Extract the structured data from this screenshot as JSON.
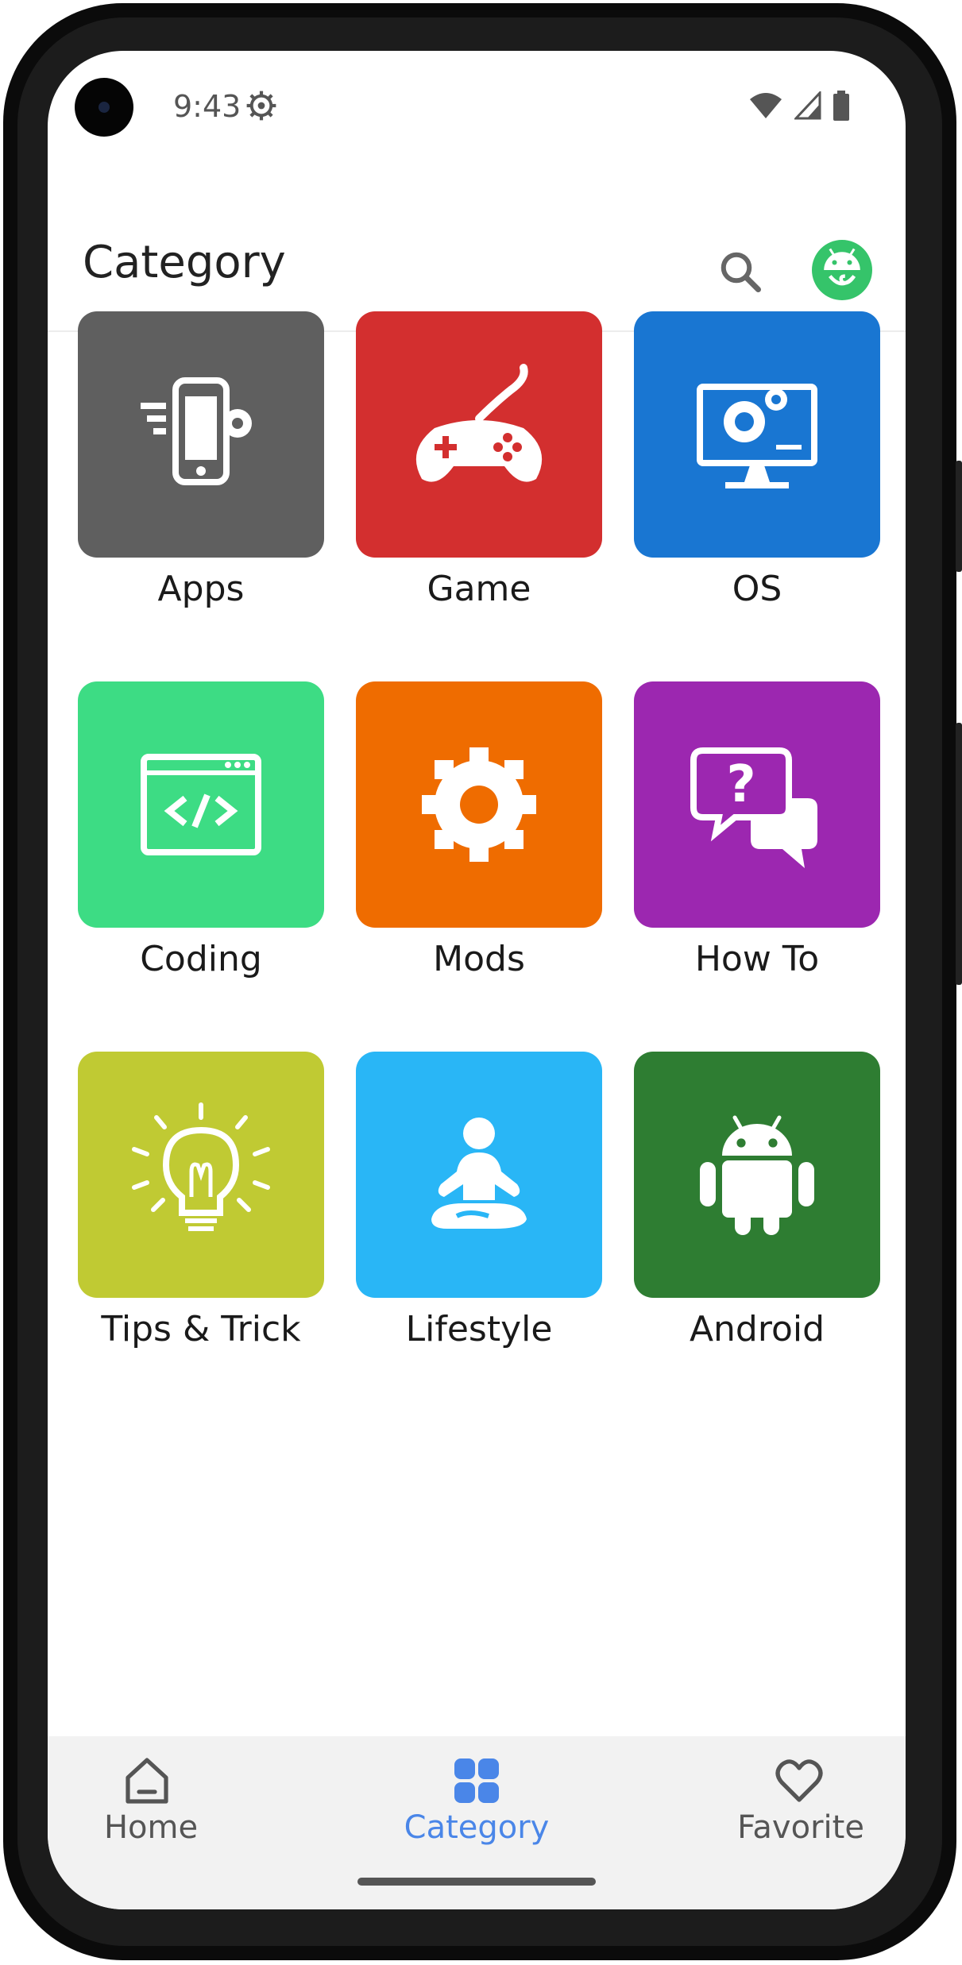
{
  "status_bar": {
    "time": "9:43"
  },
  "app_bar": {
    "title": "Category"
  },
  "categories": [
    {
      "label": "Apps",
      "color": "#5f5f5f",
      "icon": "smartphone-gear-icon"
    },
    {
      "label": "Game",
      "color": "#d32f2f",
      "icon": "gamepad-icon"
    },
    {
      "label": "OS",
      "color": "#1976d2",
      "icon": "monitor-gear-icon"
    },
    {
      "label": "Coding",
      "color": "#3ddc84",
      "icon": "code-window-icon"
    },
    {
      "label": "Mods",
      "color": "#ef6c00",
      "icon": "mods-gear-icon"
    },
    {
      "label": "How To",
      "color": "#9c27b0",
      "icon": "question-chat-icon"
    },
    {
      "label": "Tips & Trick",
      "color": "#c0ca33",
      "icon": "lightbulb-icon"
    },
    {
      "label": "Lifestyle",
      "color": "#29b6f6",
      "icon": "meditation-icon"
    },
    {
      "label": "Android",
      "color": "#2e7d32",
      "icon": "android-icon"
    }
  ],
  "bottom_nav": {
    "items": [
      {
        "label": "Home",
        "icon": "home-icon",
        "active": false
      },
      {
        "label": "Category",
        "icon": "grid-icon",
        "active": true
      },
      {
        "label": "Favorite",
        "icon": "heart-icon",
        "active": false
      }
    ],
    "active_color": "#4a86e8",
    "inactive_color": "#555555"
  }
}
